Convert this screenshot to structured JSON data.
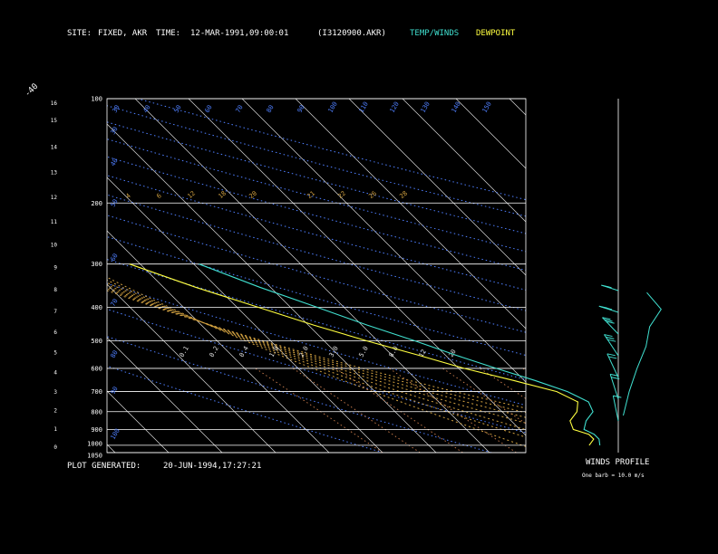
{
  "header": {
    "site_label": "SITE:",
    "site_value": "FIXED, AKR",
    "time_label": "TIME:",
    "time_value": "12-MAR-1991,09:00:01",
    "file": "(I3120900.AKR)",
    "temp_winds_label": "TEMP/WINDS",
    "dewpoint_label": "DEWPOINT"
  },
  "footer": {
    "generated_label": "PLOT GENERATED:",
    "generated_value": "20-JUN-1994,17:27:21"
  },
  "winds_profile": {
    "title": "WINDS PROFILE",
    "caption": "One barb = 10.0 m/s"
  },
  "colors": {
    "temp": "#40e0d0",
    "dewpoint": "#ffff40",
    "isobar": "#ffffff",
    "isotherm": "#ffffff",
    "dry_adiabat": "#4f7fff",
    "moist_adiabat": "#d0a040",
    "mixing_ratio": "#d08050"
  },
  "chart_data": {
    "type": "line",
    "title": "",
    "pressure_ticks": [
      100,
      200,
      300,
      400,
      500,
      600,
      700,
      800,
      900,
      1000,
      1050
    ],
    "height_ticks": [
      0,
      1,
      2,
      3,
      4,
      5,
      6,
      7,
      8,
      9,
      10,
      11,
      12,
      13,
      14,
      15,
      16
    ],
    "isotherm_labels_top": [
      -110,
      -100,
      -90,
      -80,
      -70,
      -60,
      -50,
      -40
    ],
    "isotherm_labels_right": [
      -30,
      -20,
      -10,
      0,
      10,
      20,
      30
    ],
    "dry_adiabat_labels": [
      "30",
      "40",
      "50",
      "60",
      "70",
      "80",
      "90",
      "100",
      "110",
      "120",
      "130",
      "140",
      "150"
    ],
    "moist_adiabat_labels": [
      "4",
      "6",
      "12",
      "18",
      "20",
      "21",
      "22",
      "26",
      "28"
    ],
    "mixing_ratio_labels": [
      "0.1",
      "0.2",
      "0.4",
      "1.0",
      "2.0",
      "3.0",
      "5.0",
      "8.0",
      "12",
      "20"
    ],
    "series": [
      {
        "name": "TEMP/WINDS",
        "pressure": [
          1000,
          960,
          930,
          900,
          850,
          800,
          750,
          700,
          650,
          600,
          550,
          500,
          450,
          400,
          350,
          300
        ],
        "temperature": [
          2,
          3,
          3,
          2,
          4,
          7,
          8,
          6,
          2,
          -3,
          -8,
          -13,
          -19,
          -25,
          -32,
          -39
        ]
      },
      {
        "name": "DEWPOINT",
        "pressure": [
          1000,
          960,
          930,
          900,
          850,
          800,
          750,
          700,
          650,
          600,
          550,
          500,
          450,
          400,
          350,
          300
        ],
        "temperature": [
          0,
          2,
          2,
          0,
          1,
          4,
          6,
          4,
          -2,
          -9,
          -15,
          -22,
          -29,
          -36,
          -44,
          -52
        ]
      }
    ],
    "winds": [
      {
        "pressure": 1000,
        "dir": 20,
        "speed": 10
      },
      {
        "pressure": 900,
        "dir": 30,
        "speed": 15
      },
      {
        "pressure": 800,
        "dir": 40,
        "speed": 20
      },
      {
        "pressure": 700,
        "dir": 50,
        "speed": 25
      },
      {
        "pressure": 600,
        "dir": 60,
        "speed": 25
      },
      {
        "pressure": 500,
        "dir": 80,
        "speed": 30
      },
      {
        "pressure": 400,
        "dir": 100,
        "speed": 20
      }
    ]
  }
}
